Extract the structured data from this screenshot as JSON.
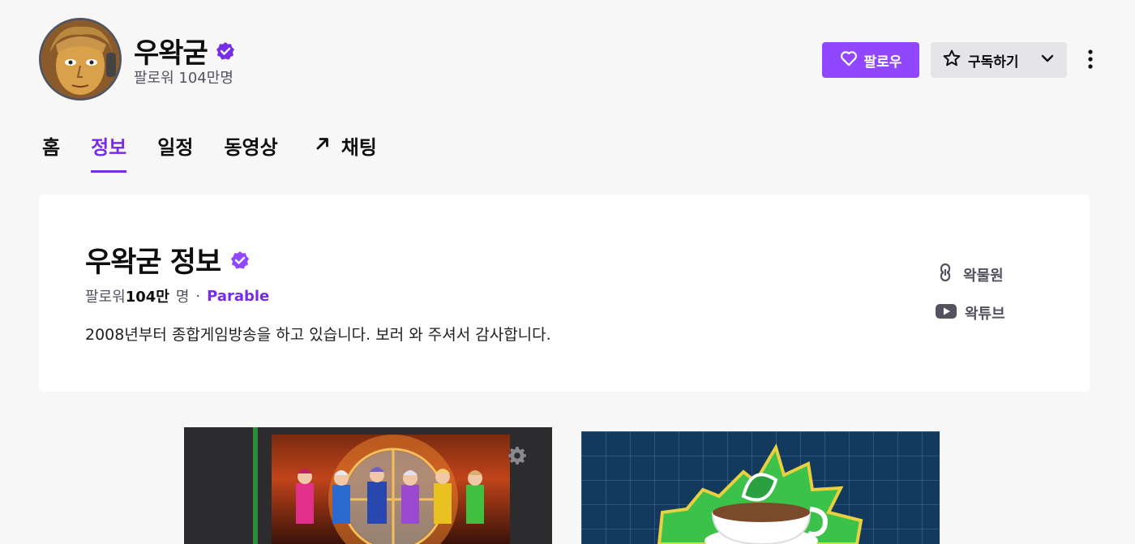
{
  "channel": {
    "name": "우왁굳",
    "followers_label": "팔로워 104만명"
  },
  "actions": {
    "follow_label": "팔로우",
    "subscribe_label": "구독하기"
  },
  "tabs": [
    {
      "label": "홈",
      "active": false
    },
    {
      "label": "정보",
      "active": true
    },
    {
      "label": "일정",
      "active": false
    },
    {
      "label": "동영상",
      "active": false
    },
    {
      "label": "채팅",
      "active": false
    }
  ],
  "about": {
    "title": "우왁굳 정보",
    "followers_prefix": "팔로워",
    "followers_count": "104만",
    "followers_suffix": "명",
    "separator": "·",
    "team": "Parable",
    "description": "2008년부터 종합게임방송을 하고 있습니다. 보러 와 주셔서 감사합니다.",
    "links": [
      {
        "label": "왁물원",
        "icon": "link-icon"
      },
      {
        "label": "왁튜브",
        "icon": "youtube-icon"
      }
    ]
  },
  "colors": {
    "accent": "#9147ff",
    "accent_text": "#772ce8",
    "background": "#f7f7f8",
    "card": "#ffffff"
  }
}
